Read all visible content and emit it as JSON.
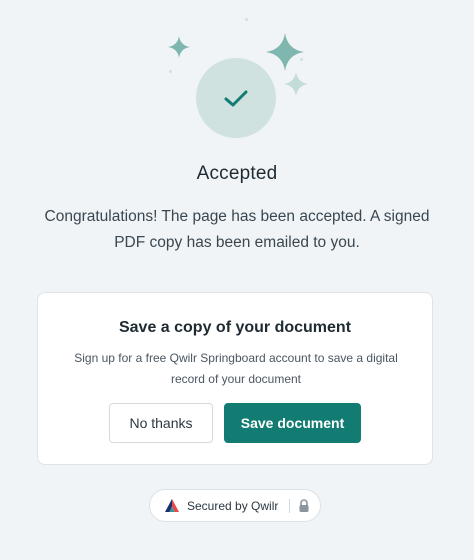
{
  "status": {
    "title": "Accepted",
    "message": "Congratulations! The page has been accepted. A signed PDF copy has been emailed to you."
  },
  "save_card": {
    "title": "Save a copy of your document",
    "description": "Sign up for a free Qwilr Springboard account to save a digital record of your document",
    "secondary_label": "No thanks",
    "primary_label": "Save document"
  },
  "footer": {
    "secured_label": "Secured by Qwilr"
  },
  "colors": {
    "accent": "#137c72",
    "sparkle": "#7fb7b0",
    "check_bg": "#cfe2e0",
    "background": "#f0f4f6"
  },
  "icons": [
    "sparkle-icon",
    "check-icon",
    "qwilr-logo-icon",
    "lock-icon"
  ]
}
